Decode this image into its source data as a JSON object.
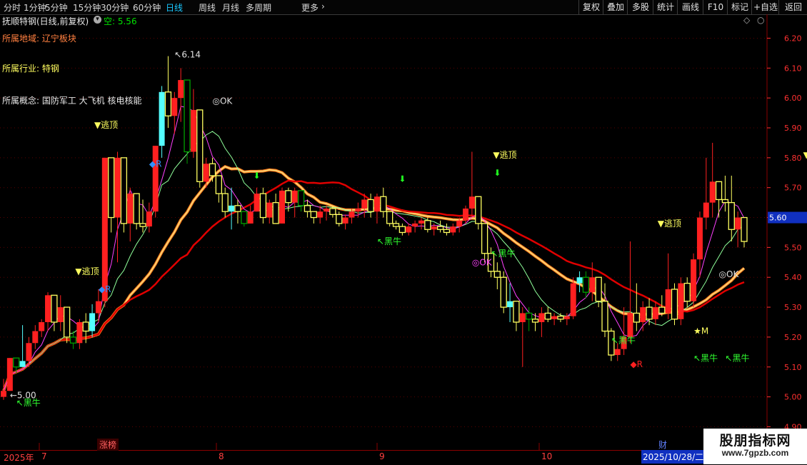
{
  "toolbar": {
    "periods": [
      "分时",
      "1分钟",
      "5分钟",
      "15分钟",
      "30分钟",
      "60分钟",
      "日线",
      "周线",
      "月线",
      "多周期",
      "更多"
    ],
    "active_period": "日线",
    "more_chevron": "chevron-right-icon",
    "right_buttons": [
      "复权",
      "叠加",
      "多股",
      "统计",
      "画线",
      "F10",
      "标记",
      "+自选",
      "返回"
    ]
  },
  "header": {
    "title": "抚顺特钢(日线,前复权)",
    "status_label": "空: 5.56"
  },
  "info": {
    "region": "所属地域: 辽宁板块",
    "industry": "所属行业: 特钢",
    "concept": "所属概念: 国防军工 大飞机 核电核能"
  },
  "signals": {
    "escape_top": "▼逃顶",
    "black_bull": "↖黑牛",
    "ok": "OK",
    "r": "R",
    "m": "M"
  },
  "annotations": {
    "high_label": "6.14",
    "low_label": "5.00",
    "current_price": "5.60"
  },
  "bottom": {
    "zhangbang": "涨榜",
    "cai": "财",
    "year": "2025年",
    "date_highlight": "2025/10/28/二",
    "month_ticks": [
      "7",
      "8",
      "9",
      "10"
    ]
  },
  "watermark": {
    "title": "股朋指标网",
    "url": "www.7gpzb.com"
  },
  "colors": {
    "up": "#ff2020",
    "down_cyan": "#54ffff",
    "green": "#00a000",
    "yellow": "#ffff60",
    "magenta": "#ff40ff",
    "axis_text": "#ff3030",
    "active_tab": "#19c8ff"
  },
  "chart_data": {
    "type": "candlestick",
    "y_range": [
      4.87,
      6.28
    ],
    "y_ticks": [
      4.9,
      5.0,
      5.1,
      5.2,
      5.3,
      5.4,
      5.5,
      5.6,
      5.7,
      5.8,
      5.9,
      6.0,
      6.1,
      6.2
    ],
    "candles": [
      [
        5.0,
        5.06,
        4.99,
        5.02
      ],
      [
        5.02,
        5.13,
        5.02,
        5.13
      ],
      [
        5.13,
        5.13,
        5.08,
        5.1
      ],
      [
        5.1,
        5.24,
        5.1,
        5.12
      ],
      [
        5.12,
        5.2,
        5.1,
        5.18
      ],
      [
        5.18,
        5.24,
        5.16,
        5.22
      ],
      [
        5.22,
        5.26,
        5.2,
        5.25
      ],
      [
        5.25,
        5.35,
        5.22,
        5.34
      ],
      [
        5.34,
        5.34,
        5.22,
        5.25
      ],
      [
        5.25,
        5.34,
        5.22,
        5.3
      ],
      [
        5.3,
        5.3,
        5.18,
        5.2
      ],
      [
        5.2,
        5.22,
        5.16,
        5.18
      ],
      [
        5.18,
        5.26,
        5.16,
        5.25
      ],
      [
        5.25,
        5.28,
        5.18,
        5.22
      ],
      [
        5.22,
        5.31,
        5.2,
        5.28
      ],
      [
        5.28,
        5.36,
        5.25,
        5.32
      ],
      [
        5.32,
        5.8,
        5.3,
        5.8
      ],
      [
        5.8,
        5.8,
        5.55,
        5.6
      ],
      [
        5.6,
        5.82,
        5.45,
        5.8
      ],
      [
        5.8,
        5.8,
        5.55,
        5.58
      ],
      [
        5.58,
        5.7,
        5.52,
        5.68
      ],
      [
        5.68,
        5.68,
        5.56,
        5.58
      ],
      [
        5.58,
        5.66,
        5.55,
        5.57
      ],
      [
        5.57,
        5.65,
        5.55,
        5.62
      ],
      [
        5.62,
        5.84,
        5.6,
        5.84
      ],
      [
        5.84,
        6.04,
        5.8,
        6.02
      ],
      [
        6.02,
        6.14,
        5.9,
        5.94
      ],
      [
        5.94,
        6.02,
        5.88,
        6.0
      ],
      [
        6.0,
        6.1,
        5.92,
        6.06
      ],
      [
        6.06,
        6.06,
        5.78,
        5.82
      ],
      [
        5.82,
        6.03,
        5.8,
        5.96
      ],
      [
        5.96,
        5.96,
        5.7,
        5.72
      ],
      [
        5.72,
        5.8,
        5.7,
        5.78
      ],
      [
        5.78,
        5.8,
        5.72,
        5.74
      ],
      [
        5.74,
        5.74,
        5.65,
        5.68
      ],
      [
        5.68,
        5.7,
        5.6,
        5.62
      ],
      [
        5.62,
        5.7,
        5.56,
        5.64
      ],
      [
        5.64,
        5.66,
        5.58,
        5.62
      ],
      [
        5.62,
        5.62,
        5.57,
        5.58
      ],
      [
        5.58,
        5.64,
        5.58,
        5.62
      ],
      [
        5.62,
        5.7,
        5.62,
        5.68
      ],
      [
        5.68,
        5.7,
        5.58,
        5.6
      ],
      [
        5.6,
        5.66,
        5.58,
        5.65
      ],
      [
        5.65,
        5.68,
        5.58,
        5.58
      ],
      [
        5.58,
        5.7,
        5.58,
        5.69
      ],
      [
        5.69,
        5.7,
        5.62,
        5.65
      ],
      [
        5.65,
        5.7,
        5.6,
        5.69
      ],
      [
        5.69,
        5.69,
        5.62,
        5.64
      ],
      [
        5.64,
        5.66,
        5.6,
        5.62
      ],
      [
        5.62,
        5.62,
        5.58,
        5.6
      ],
      [
        5.6,
        5.64,
        5.58,
        5.62
      ],
      [
        5.62,
        5.64,
        5.59,
        5.63
      ],
      [
        5.63,
        5.64,
        5.6,
        5.61
      ],
      [
        5.61,
        5.62,
        5.57,
        5.58
      ],
      [
        5.58,
        5.61,
        5.56,
        5.6
      ],
      [
        5.6,
        5.63,
        5.58,
        5.62
      ],
      [
        5.62,
        5.65,
        5.6,
        5.63
      ],
      [
        5.63,
        5.68,
        5.6,
        5.66
      ],
      [
        5.66,
        5.68,
        5.6,
        5.62
      ],
      [
        5.62,
        5.68,
        5.58,
        5.67
      ],
      [
        5.67,
        5.7,
        5.6,
        5.62
      ],
      [
        5.62,
        5.62,
        5.57,
        5.58
      ],
      [
        5.58,
        5.59,
        5.56,
        5.57
      ],
      [
        5.57,
        5.58,
        5.54,
        5.55
      ],
      [
        5.55,
        5.58,
        5.54,
        5.57
      ],
      [
        5.57,
        5.59,
        5.55,
        5.58
      ],
      [
        5.58,
        5.6,
        5.56,
        5.59
      ],
      [
        5.59,
        5.6,
        5.55,
        5.56
      ],
      [
        5.56,
        5.58,
        5.54,
        5.57
      ],
      [
        5.57,
        5.59,
        5.55,
        5.56
      ],
      [
        5.56,
        5.58,
        5.54,
        5.55
      ],
      [
        5.55,
        5.58,
        5.54,
        5.57
      ],
      [
        5.57,
        5.6,
        5.55,
        5.59
      ],
      [
        5.59,
        5.64,
        5.58,
        5.63
      ],
      [
        5.63,
        5.82,
        5.6,
        5.67
      ],
      [
        5.67,
        5.67,
        5.56,
        5.58
      ],
      [
        5.58,
        5.58,
        5.45,
        5.48
      ],
      [
        5.48,
        5.5,
        5.4,
        5.42
      ],
      [
        5.42,
        5.45,
        5.36,
        5.4
      ],
      [
        5.4,
        5.42,
        5.28,
        5.3
      ],
      [
        5.3,
        5.38,
        5.25,
        5.32
      ],
      [
        5.32,
        5.32,
        5.22,
        5.25
      ],
      [
        5.25,
        5.3,
        5.1,
        5.28
      ],
      [
        5.28,
        5.3,
        5.22,
        5.26
      ],
      [
        5.26,
        5.28,
        5.22,
        5.25
      ],
      [
        5.25,
        5.3,
        5.2,
        5.28
      ],
      [
        5.28,
        5.3,
        5.25,
        5.26
      ],
      [
        5.26,
        5.28,
        5.24,
        5.27
      ],
      [
        5.27,
        5.28,
        5.25,
        5.26
      ],
      [
        5.26,
        5.28,
        5.24,
        5.27
      ],
      [
        5.27,
        5.4,
        5.26,
        5.38
      ],
      [
        5.38,
        5.42,
        5.35,
        5.4
      ],
      [
        5.4,
        5.42,
        5.33,
        5.35
      ],
      [
        5.35,
        5.45,
        5.32,
        5.4
      ],
      [
        5.4,
        5.4,
        5.3,
        5.32
      ],
      [
        5.32,
        5.38,
        5.2,
        5.22
      ],
      [
        5.22,
        5.23,
        5.12,
        5.14
      ],
      [
        5.14,
        5.18,
        5.12,
        5.16
      ],
      [
        5.16,
        5.3,
        5.14,
        5.2
      ],
      [
        5.2,
        5.52,
        5.18,
        5.28
      ],
      [
        5.28,
        5.38,
        5.22,
        5.25
      ],
      [
        5.25,
        5.32,
        5.22,
        5.3
      ],
      [
        5.3,
        5.33,
        5.24,
        5.26
      ],
      [
        5.26,
        5.32,
        5.24,
        5.3
      ],
      [
        5.3,
        5.34,
        5.27,
        5.28
      ],
      [
        5.28,
        5.48,
        5.26,
        5.36
      ],
      [
        5.36,
        5.38,
        5.24,
        5.26
      ],
      [
        5.26,
        5.4,
        5.24,
        5.38
      ],
      [
        5.38,
        5.4,
        5.3,
        5.32
      ],
      [
        5.32,
        5.48,
        5.3,
        5.46
      ],
      [
        5.46,
        5.62,
        5.4,
        5.6
      ],
      [
        5.6,
        5.8,
        5.56,
        5.65
      ],
      [
        5.65,
        5.85,
        5.6,
        5.72
      ],
      [
        5.72,
        5.72,
        5.6,
        5.66
      ],
      [
        5.66,
        5.74,
        5.62,
        5.65
      ],
      [
        5.65,
        5.74,
        5.52,
        5.56
      ],
      [
        5.56,
        5.62,
        5.5,
        5.6
      ],
      [
        5.6,
        5.6,
        5.5,
        5.52
      ]
    ]
  }
}
